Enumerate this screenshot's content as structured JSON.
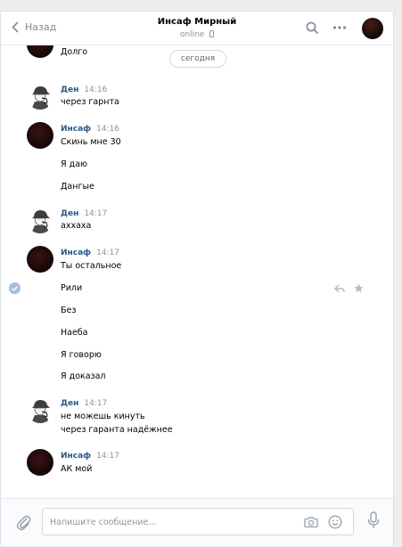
{
  "header": {
    "back_label": "Назад",
    "title": "Инсаф Мирный",
    "status": "online"
  },
  "date_label": "сегодня",
  "messages": [
    {
      "author": "",
      "time": "",
      "lines": [
        "Долго"
      ]
    },
    {
      "author": "Ден",
      "time": "14:16",
      "lines": [
        "через гарнта"
      ]
    },
    {
      "author": "Инсаф",
      "time": "14:16",
      "lines": [
        "Скинь мне 30",
        "Я даю",
        "Дангые"
      ]
    },
    {
      "author": "Ден",
      "time": "14:17",
      "lines": [
        "аххаха"
      ]
    },
    {
      "author": "Инсаф",
      "time": "14:17",
      "lines": [
        "Ты остальное",
        "Рили",
        "Без",
        "Наеба",
        "Я говорю",
        "Я доказал"
      ]
    },
    {
      "author": "Ден",
      "time": "14:17",
      "lines": [
        "не можешь кинуть",
        "через гаранта надёжнее"
      ]
    },
    {
      "author": "Инсаф",
      "time": "14:17",
      "lines": [
        "АК мой"
      ]
    }
  ],
  "composer": {
    "placeholder": "Напишите сообщение..."
  },
  "icons": {
    "back": "chevron-left-icon",
    "search": "search-icon",
    "more": "more-dots-icon",
    "phone": "mobile-phone-icon",
    "reply": "reply-icon",
    "star": "star-icon",
    "check": "check-circle-icon",
    "attach": "paperclip-icon",
    "camera": "camera-icon",
    "smile": "smile-icon",
    "mic": "microphone-icon"
  },
  "colors": {
    "author": "#2a5885",
    "muted": "#939393",
    "background": "#edeef0"
  }
}
